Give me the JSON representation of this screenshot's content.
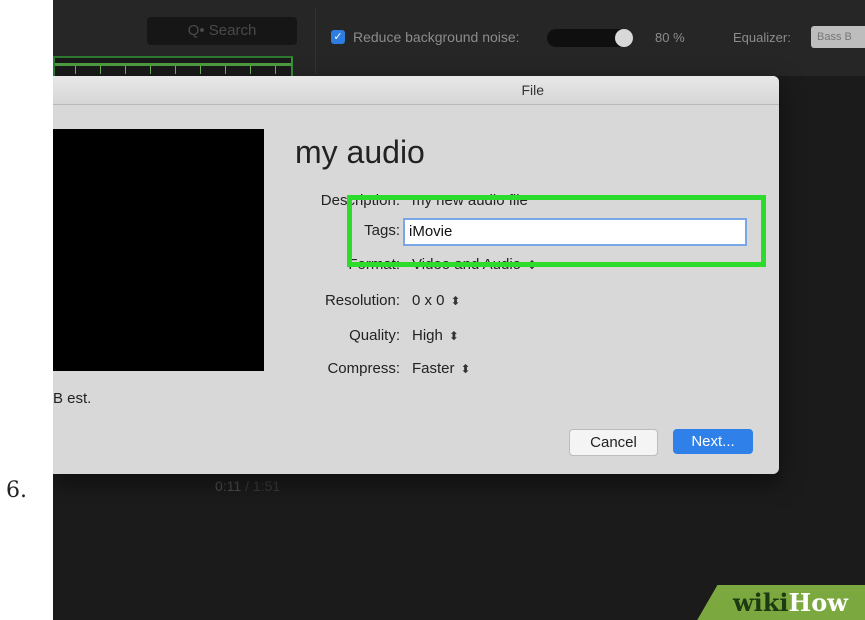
{
  "step_number": "6.",
  "topbar": {
    "search_placeholder": "Q• Search",
    "noise_label": "Reduce background noise:",
    "noise_percent": "80 %",
    "noise_level": 0.8,
    "equalizer_label": "Equalizer:",
    "equalizer_value": "Bass B"
  },
  "dialog": {
    "title": "File",
    "project_title": "my audio",
    "size_estimate": "B est.",
    "fields": {
      "description_label": "Description:",
      "description_value": "my new audio file",
      "tags_label": "Tags:",
      "tags_value": "iMovie",
      "format_label": "Format:",
      "format_value": "Video and Audio",
      "resolution_label": "Resolution:",
      "resolution_value": "0 x 0",
      "quality_label": "Quality:",
      "quality_value": "High",
      "compress_label": "Compress:",
      "compress_value": "Faster"
    },
    "cancel_label": "Cancel",
    "next_label": "Next..."
  },
  "timeline": {
    "current": "0:11",
    "separator": " / ",
    "total": "1:51"
  },
  "watermark": {
    "part1": "wiki",
    "part2": "How"
  },
  "colors": {
    "highlight": "#2ddb2d",
    "accent": "#2f80e8",
    "clip_green": "#4d9c3f"
  }
}
